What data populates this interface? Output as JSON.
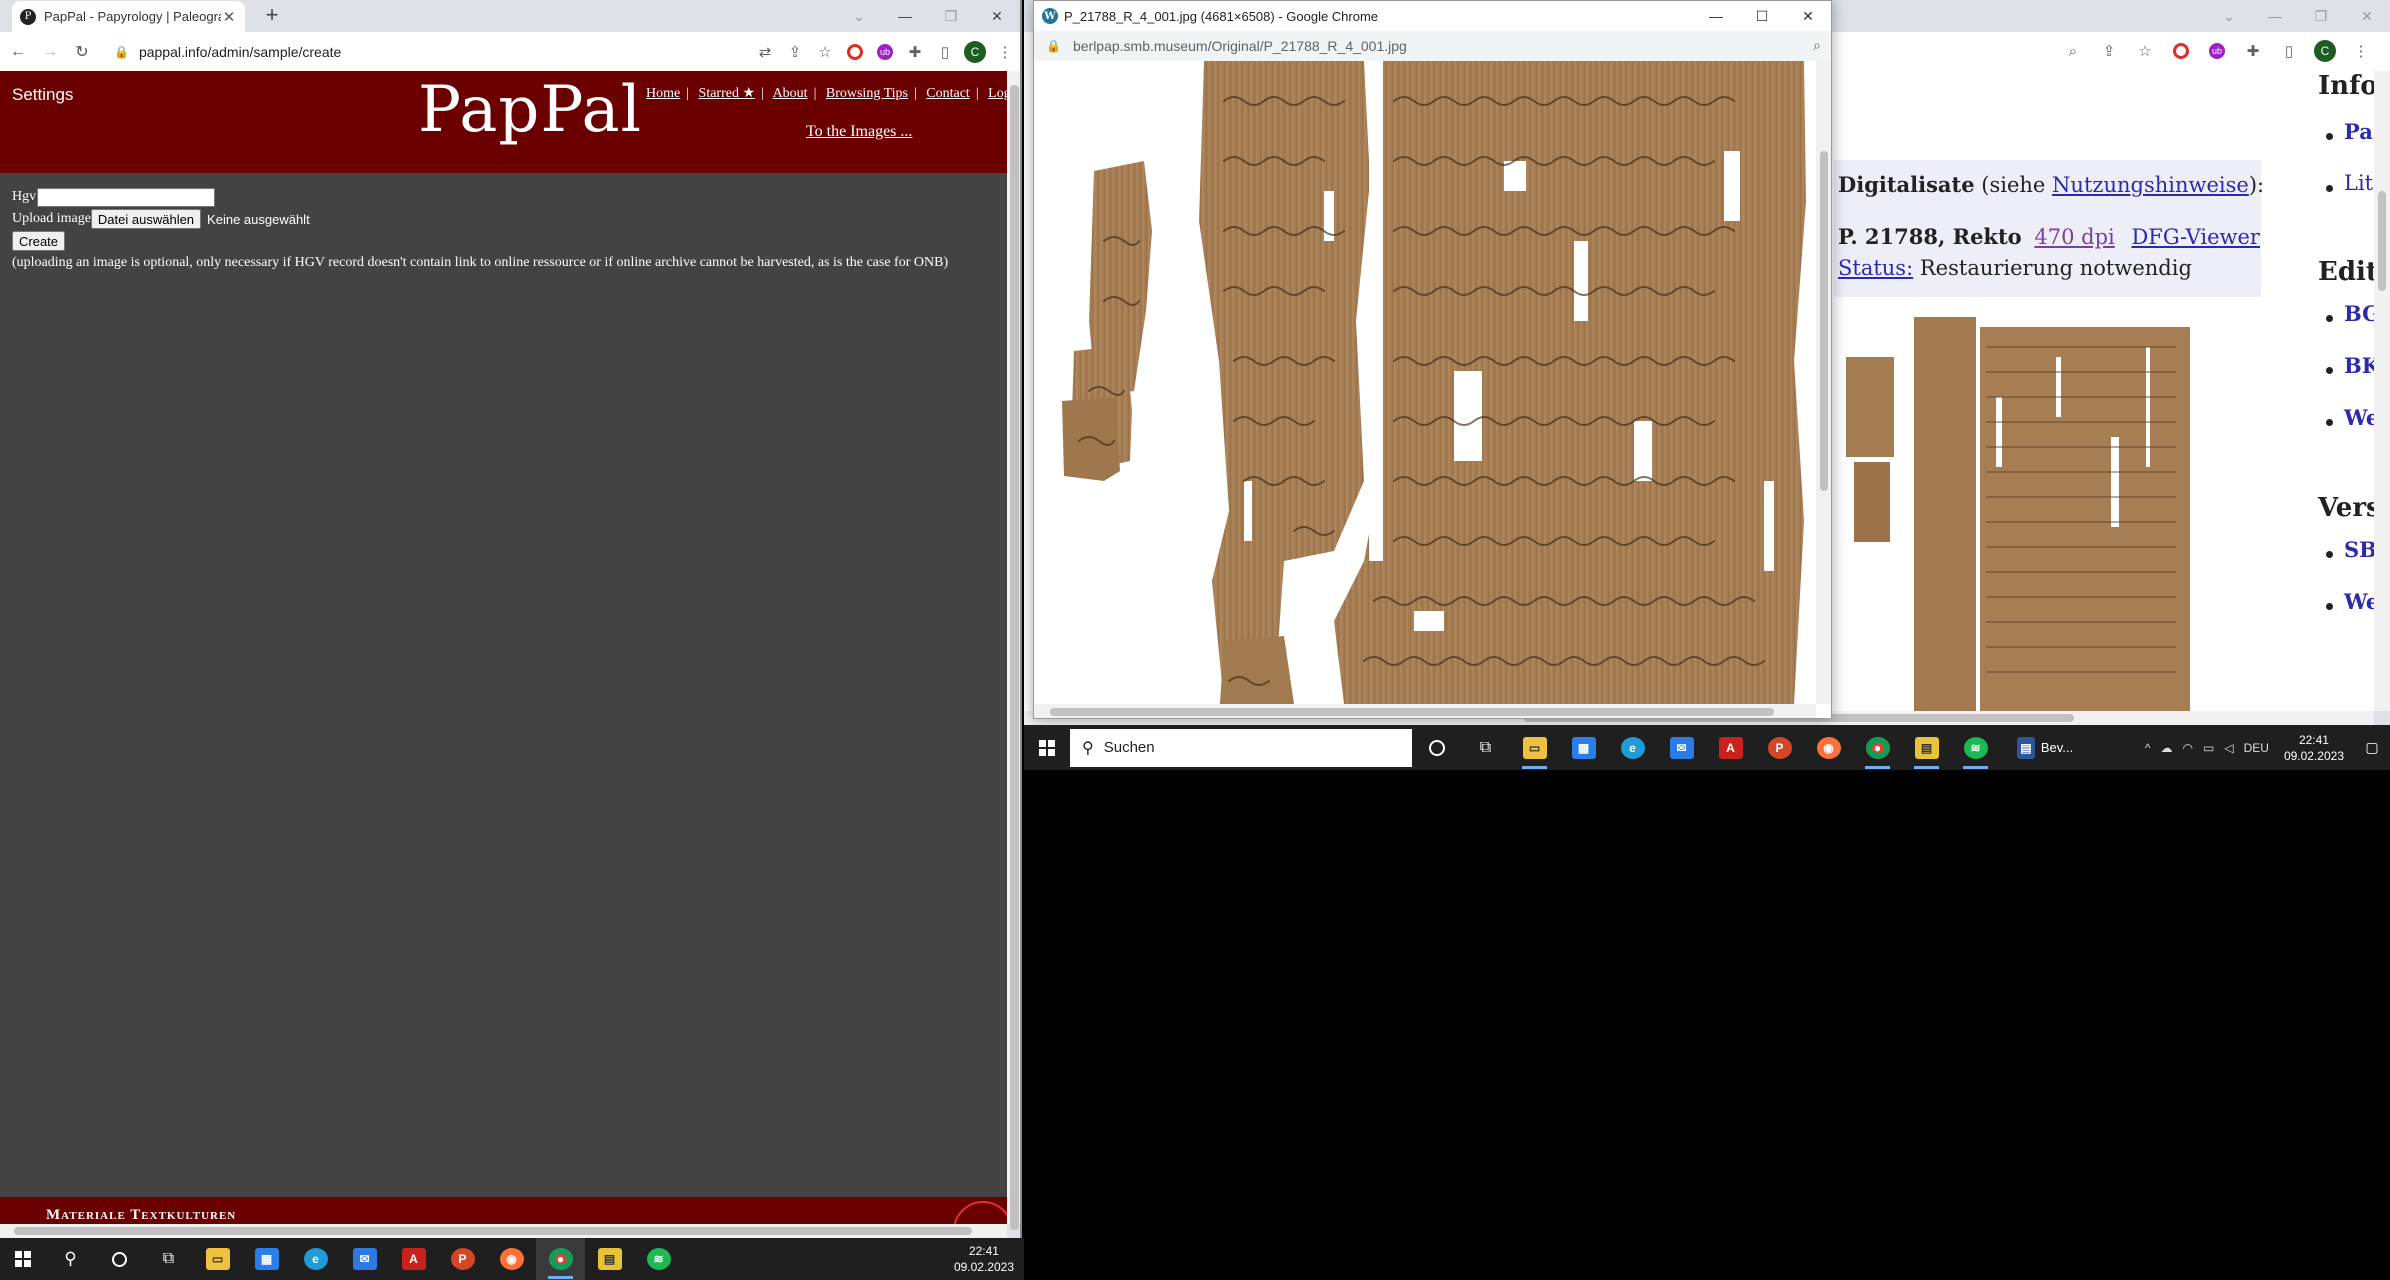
{
  "left_window": {
    "tab_title": "PapPal - Papyrology | Paleograph",
    "url": "pappal.info/admin/sample/create",
    "page": {
      "settings_label": "Settings",
      "logo": "PapPal",
      "nav": [
        "Home",
        "Starred ★",
        "About",
        "Browsing Tips",
        "Contact",
        "Logou"
      ],
      "to_images": "To the Images ...",
      "hgv_label": "Hgv",
      "upload_label": "Upload image",
      "file_button": "Datei auswählen",
      "file_status": "Keine ausgewählt",
      "create_button": "Create",
      "note": "(uploading an image is optional, only necessary if HGV record doesn't contain link to online ressource or if online archive cannot be harvested, as is the case for ONB)",
      "footer_text": "Materiale Textkulturen"
    }
  },
  "popup_window": {
    "title": "P_21788_R_4_001.jpg (4681×6508) - Google Chrome",
    "url": "berlpap.smb.museum/Original/P_21788_R_4_001.jpg"
  },
  "right_window": {
    "digitalisate_label": "Digitalisate",
    "digitalisate_paren_open": "(siehe ",
    "usage_link": "Nutzungshinweise",
    "digitalisate_paren_close": "):",
    "item_label": "P. 21788, Rekto",
    "dpi_link": "470 dpi",
    "dfg_link": "DFG-Viewer",
    "status_link": "Status:",
    "status_value": "Restaurierung notwendig",
    "side": {
      "heading_1": "Infor",
      "item_1a": "Pa",
      "item_1b": "Lit",
      "heading_2": "Editi",
      "item_2a": "BG",
      "item_2b": "BK",
      "item_2c": "We",
      "heading_3": "Vers",
      "item_3a": "SB",
      "item_3b": "We"
    }
  },
  "taskbar_right": {
    "search_placeholder": "Suchen",
    "app_label": "Bev...",
    "lang": "DEU",
    "time": "22:41",
    "date": "09.02.2023"
  },
  "taskbar_left": {
    "time": "22:41",
    "date": "09.02.2023"
  },
  "colors": {
    "banner": "#6b0000",
    "page_bg": "#434343",
    "papyrus": "#a07850"
  }
}
